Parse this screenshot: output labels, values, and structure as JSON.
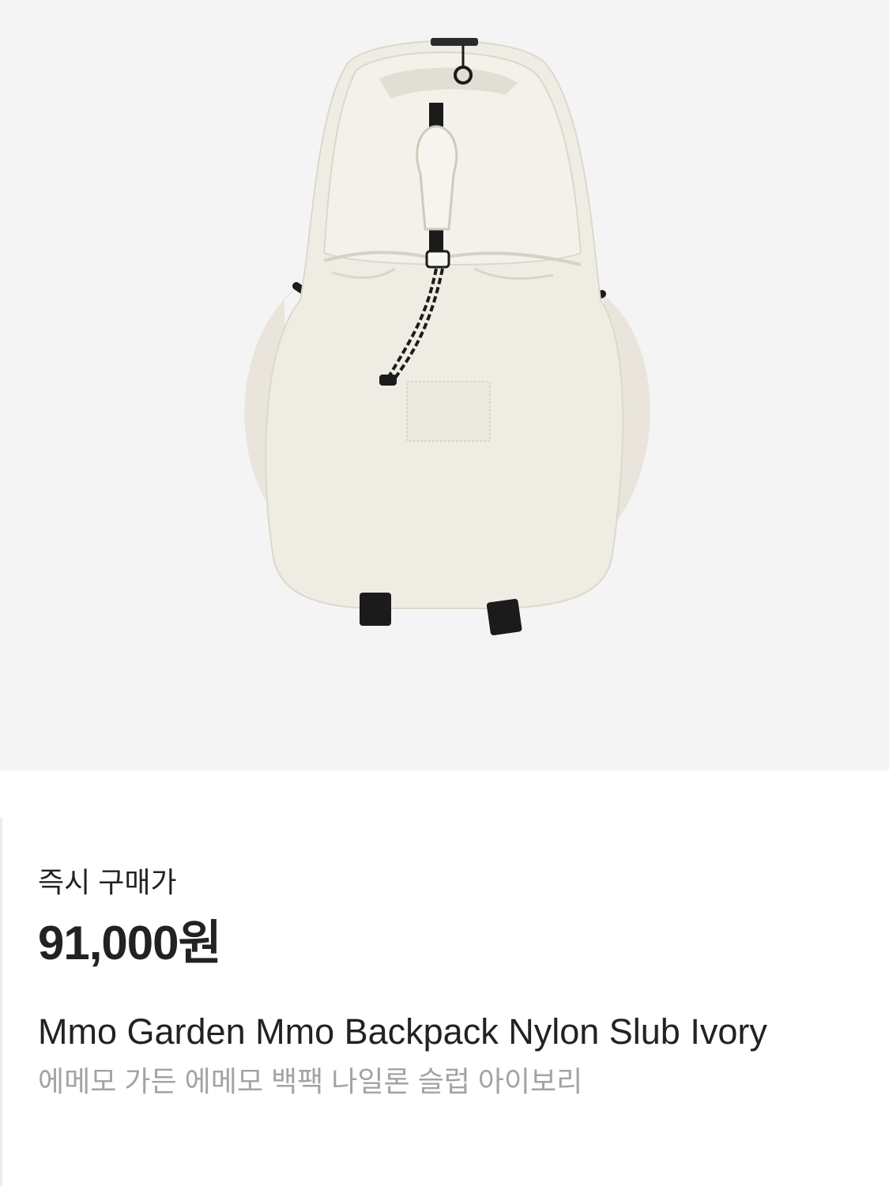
{
  "product": {
    "image_alt": "backpack-ivory",
    "price_label": "즉시 구매가",
    "price": "91,000원",
    "name_en": "Mmo Garden Mmo Backpack Nylon Slub Ivory",
    "name_ko": "에메모 가든 에메모 백팩 나일론 슬럽 아이보리"
  },
  "colors": {
    "image_bg": "#f4f4f4",
    "bag_body": "#efece3",
    "strap": "#1b1b1b",
    "text_primary": "#222222",
    "text_secondary": "#a3a3a3"
  }
}
